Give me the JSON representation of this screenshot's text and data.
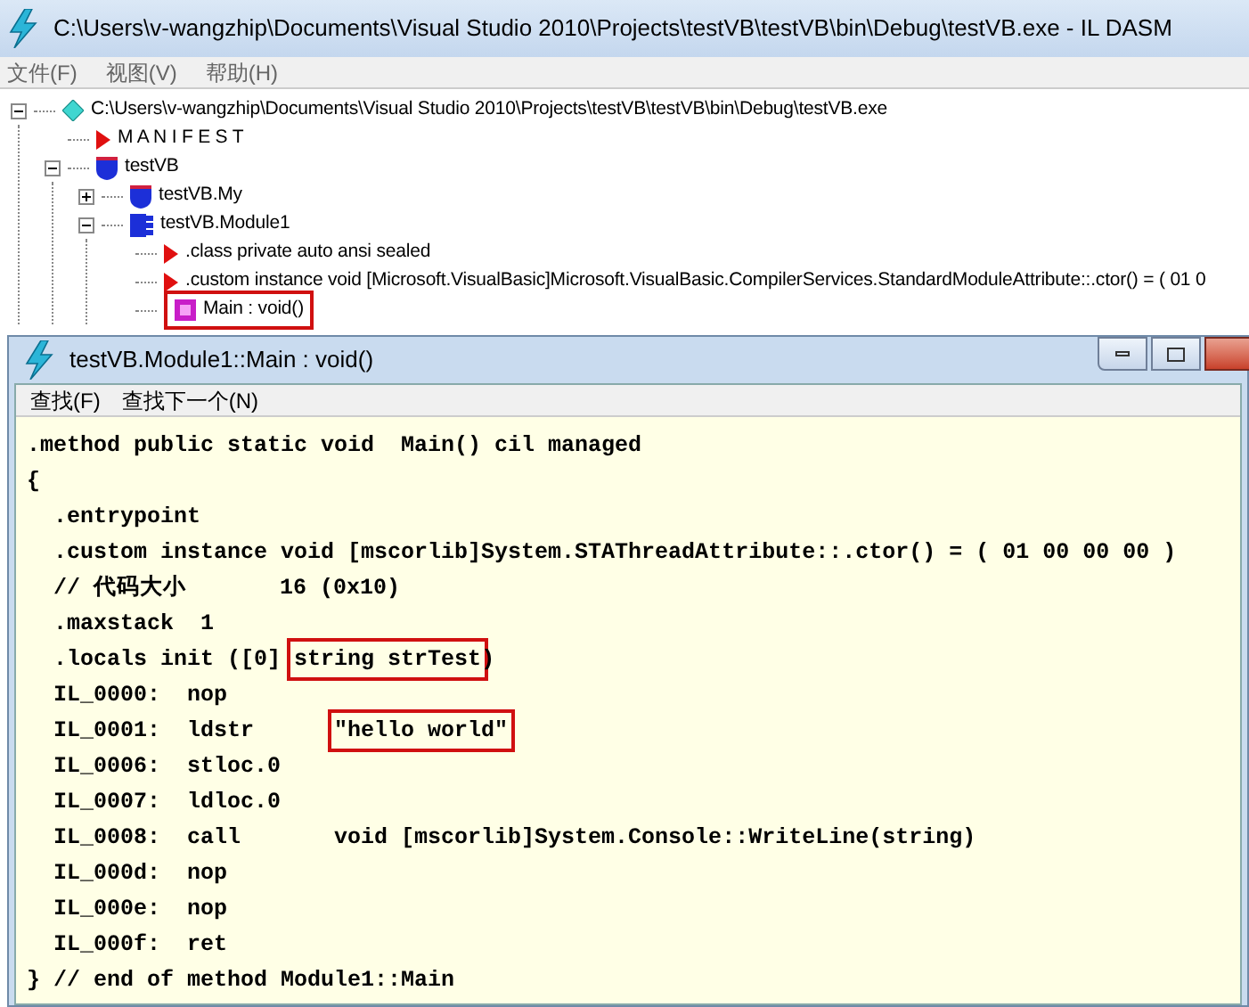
{
  "main_window": {
    "title": "C:\\Users\\v-wangzhip\\Documents\\Visual Studio 2010\\Projects\\testVB\\testVB\\bin\\Debug\\testVB.exe - IL DASM",
    "menu": [
      "文件(F)",
      "视图(V)",
      "帮助(H)"
    ],
    "tree": [
      {
        "label": "C:\\Users\\v-wangzhip\\Documents\\Visual Studio 2010\\Projects\\testVB\\testVB\\bin\\Debug\\testVB.exe",
        "kind": "assembly",
        "expanded": true,
        "children": [
          {
            "label": "M A N I F E S T",
            "kind": "manifest"
          },
          {
            "label": "testVB",
            "kind": "namespace",
            "expanded": true,
            "children": [
              {
                "label": "testVB.My",
                "kind": "namespace",
                "expanded": false
              },
              {
                "label": "testVB.Module1",
                "kind": "class",
                "expanded": true,
                "children": [
                  {
                    "label": ".class private auto ansi sealed",
                    "kind": "info"
                  },
                  {
                    "label": ".custom instance void [Microsoft.VisualBasic]Microsoft.VisualBasic.CompilerServices.StandardModuleAttribute::.ctor() = ( 01 0",
                    "kind": "info"
                  },
                  {
                    "label": "Main : void()",
                    "kind": "static_method",
                    "boxed": true
                  }
                ]
              }
            ]
          }
        ]
      }
    ]
  },
  "code_window": {
    "title": "testVB.Module1::Main : void()",
    "menu": [
      "查找(F)",
      "查找下一个(N)"
    ],
    "lines": [
      [
        {
          "text": ".method public static void  Main() cil managed"
        }
      ],
      [
        {
          "text": "{"
        }
      ],
      [
        {
          "text": "  .entrypoint"
        }
      ],
      [
        {
          "text": "  .custom instance void [mscorlib]System.STAThreadAttribute::.ctor() = ( 01 00 00 00 )"
        }
      ],
      [
        {
          "text": "  // 代码大小       16 (0x10)"
        }
      ],
      [
        {
          "text": "  .maxstack  1"
        }
      ],
      [
        {
          "text": "  .locals init ([0] "
        },
        {
          "text": "string strTest",
          "boxed": true
        },
        {
          "text": ")"
        }
      ],
      [
        {
          "text": "  IL_0000:  nop"
        }
      ],
      [
        {
          "text": "  IL_0001:  ldstr      "
        },
        {
          "text": "\"hello world\"",
          "boxed": true
        }
      ],
      [
        {
          "text": "  IL_0006:  stloc.0"
        }
      ],
      [
        {
          "text": "  IL_0007:  ldloc.0"
        }
      ],
      [
        {
          "text": "  IL_0008:  call       void [mscorlib]System.Console::WriteLine(string)"
        }
      ],
      [
        {
          "text": "  IL_000d:  nop"
        }
      ],
      [
        {
          "text": "  IL_000e:  nop"
        }
      ],
      [
        {
          "text": "  IL_000f:  ret"
        }
      ],
      [
        {
          "text": "} // end of method Module1::Main"
        }
      ]
    ]
  }
}
